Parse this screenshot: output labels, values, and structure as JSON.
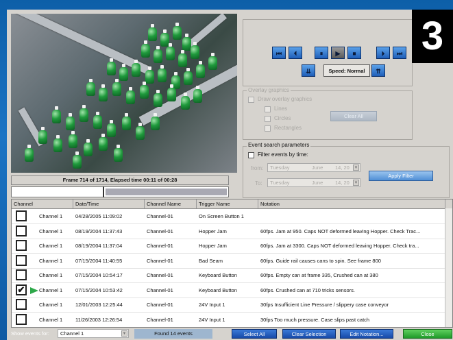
{
  "badge": "3",
  "video": {
    "frame_info": "Frame 714 of 1714,  Elapsed time 00:11 of 00:28",
    "progress": 0.42
  },
  "transport": {
    "buttons": [
      "⏮",
      "⏴",
      "⏸",
      "▶",
      "⏹",
      "⏵",
      "⏭"
    ],
    "speed_label": "Speed: Normal"
  },
  "overlay": {
    "group_label": "Overlay graphics",
    "draw_label": "Draw overlay graphics",
    "lines_label": "Lines",
    "circles_label": "Circles",
    "rectangles_label": "Rectangles",
    "clear_all_label": "Clear All"
  },
  "search": {
    "group_label": "Event search parameters",
    "filter_time_label": "Filter events by time:",
    "from_label": "from:",
    "to_label": "To:",
    "from_day": "Tuesday",
    "from_month": "June",
    "from_date": "14, 20",
    "to_day": "Tuesday",
    "to_month": "June",
    "to_date": "14, 20",
    "apply_label": "Apply Filter"
  },
  "table": {
    "columns": [
      "Channel",
      "Date/Time",
      "Channel Name",
      "Trigger Name",
      "Notation"
    ],
    "rows": [
      {
        "checked": false,
        "channel": "Channel 1",
        "datetime": "04/28/2005  11:09:02",
        "name": "Channel-01",
        "trigger": "On Screen Button 1",
        "notation": ""
      },
      {
        "checked": false,
        "channel": "Channel 1",
        "datetime": "08/19/2004  11:37:43",
        "name": "Channel-01",
        "trigger": "Hopper Jam",
        "notation": "60fps. Jam at 950. Caps NOT deformed leaving Hopper. Check Trac..."
      },
      {
        "checked": false,
        "channel": "Channel 1",
        "datetime": "08/19/2004  11:37:04",
        "name": "Channel-01",
        "trigger": "Hopper Jam",
        "notation": "60fps. Jam at 3300. Caps NOT deformed leaving Hopper. Check tra..."
      },
      {
        "checked": false,
        "channel": "Channel 1",
        "datetime": "07/15/2004  11:40:55",
        "name": "Channel-01",
        "trigger": "Bad Seam",
        "notation": "60fps. Guide rail causes cans to spin.  See frame 800"
      },
      {
        "checked": false,
        "channel": "Channel 1",
        "datetime": "07/15/2004  10:54:17",
        "name": "Channel-01",
        "trigger": "Keyboard Button",
        "notation": "60fps. Empty can at frame 335, Crushed can at 380"
      },
      {
        "checked": true,
        "channel": "Channel 1",
        "datetime": "07/15/2004  10:53:42",
        "name": "Channel-01",
        "trigger": "Keyboard Button",
        "notation": "60fps. Crushed can at 710 tricks sensors."
      },
      {
        "checked": false,
        "channel": "Channel 1",
        "datetime": "12/01/2003  12:25:44",
        "name": "Channel-01",
        "trigger": "24V Input 1",
        "notation": "30fps Insufficient Line Pressure / slippery case conveyor"
      },
      {
        "checked": false,
        "channel": "Channel 1",
        "datetime": "11/26/2003  12:26:54",
        "name": "Channel-01",
        "trigger": "24V Input 1",
        "notation": "30fps Too much pressure.  Case slips past catch"
      }
    ]
  },
  "footer": {
    "show_events_label": "Show events for:",
    "show_events_value": "Channel 1",
    "found_label": "Found 14 events",
    "select_all": "Select All",
    "clear_selection": "Clear Selection",
    "edit_notation": "Edit Notation...",
    "close": "Close"
  }
}
